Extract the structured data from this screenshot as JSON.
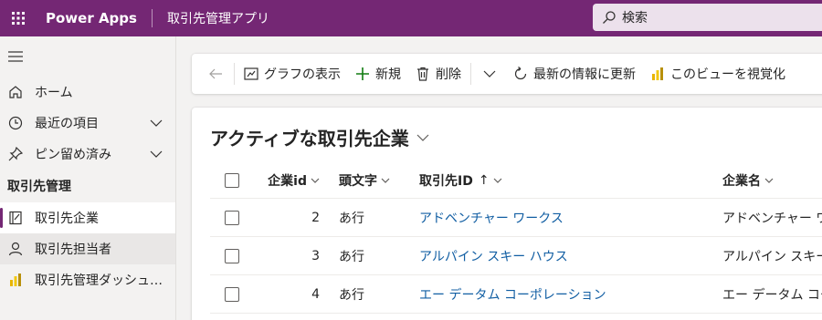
{
  "topbar": {
    "brand": "Power Apps",
    "app_name": "取引先管理アプリ",
    "search_placeholder": "検索",
    "color": "#742774"
  },
  "sidebar": {
    "items": [
      {
        "label": "ホーム",
        "icon": "home-icon"
      },
      {
        "label": "最近の項目",
        "icon": "clock-icon",
        "expandable": true
      },
      {
        "label": "ピン留め済み",
        "icon": "pin-icon",
        "expandable": true
      }
    ],
    "group_title": "取引先管理",
    "group_items": [
      {
        "label": "取引先企業",
        "icon": "account-icon",
        "active": true
      },
      {
        "label": "取引先担当者",
        "icon": "person-icon"
      },
      {
        "label": "取引先管理ダッシュボード",
        "icon": "powerbi-icon"
      }
    ]
  },
  "commandbar": {
    "chart_label": "グラフの表示",
    "new_label": "新規",
    "delete_label": "削除",
    "refresh_label": "最新の情報に更新",
    "visualize_label": "このビューを視覚化"
  },
  "view": {
    "title": "アクティブな取引先企業"
  },
  "table": {
    "columns": {
      "id": "企業id",
      "head": "頭文字",
      "account_id": "取引先ID",
      "name": "企業名",
      "sort_indicator": "↑"
    },
    "rows": [
      {
        "id": "2",
        "head": "あ行",
        "account_id": "アドベンチャー ワークス",
        "name": "アドベンチャー ワークス"
      },
      {
        "id": "3",
        "head": "あ行",
        "account_id": "アルパイン スキー ハウス",
        "name": "アルパイン スキー ハウス"
      },
      {
        "id": "4",
        "head": "あ行",
        "account_id": "エー データム コーポレーション",
        "name": "エー データム コーポレーション"
      }
    ]
  }
}
